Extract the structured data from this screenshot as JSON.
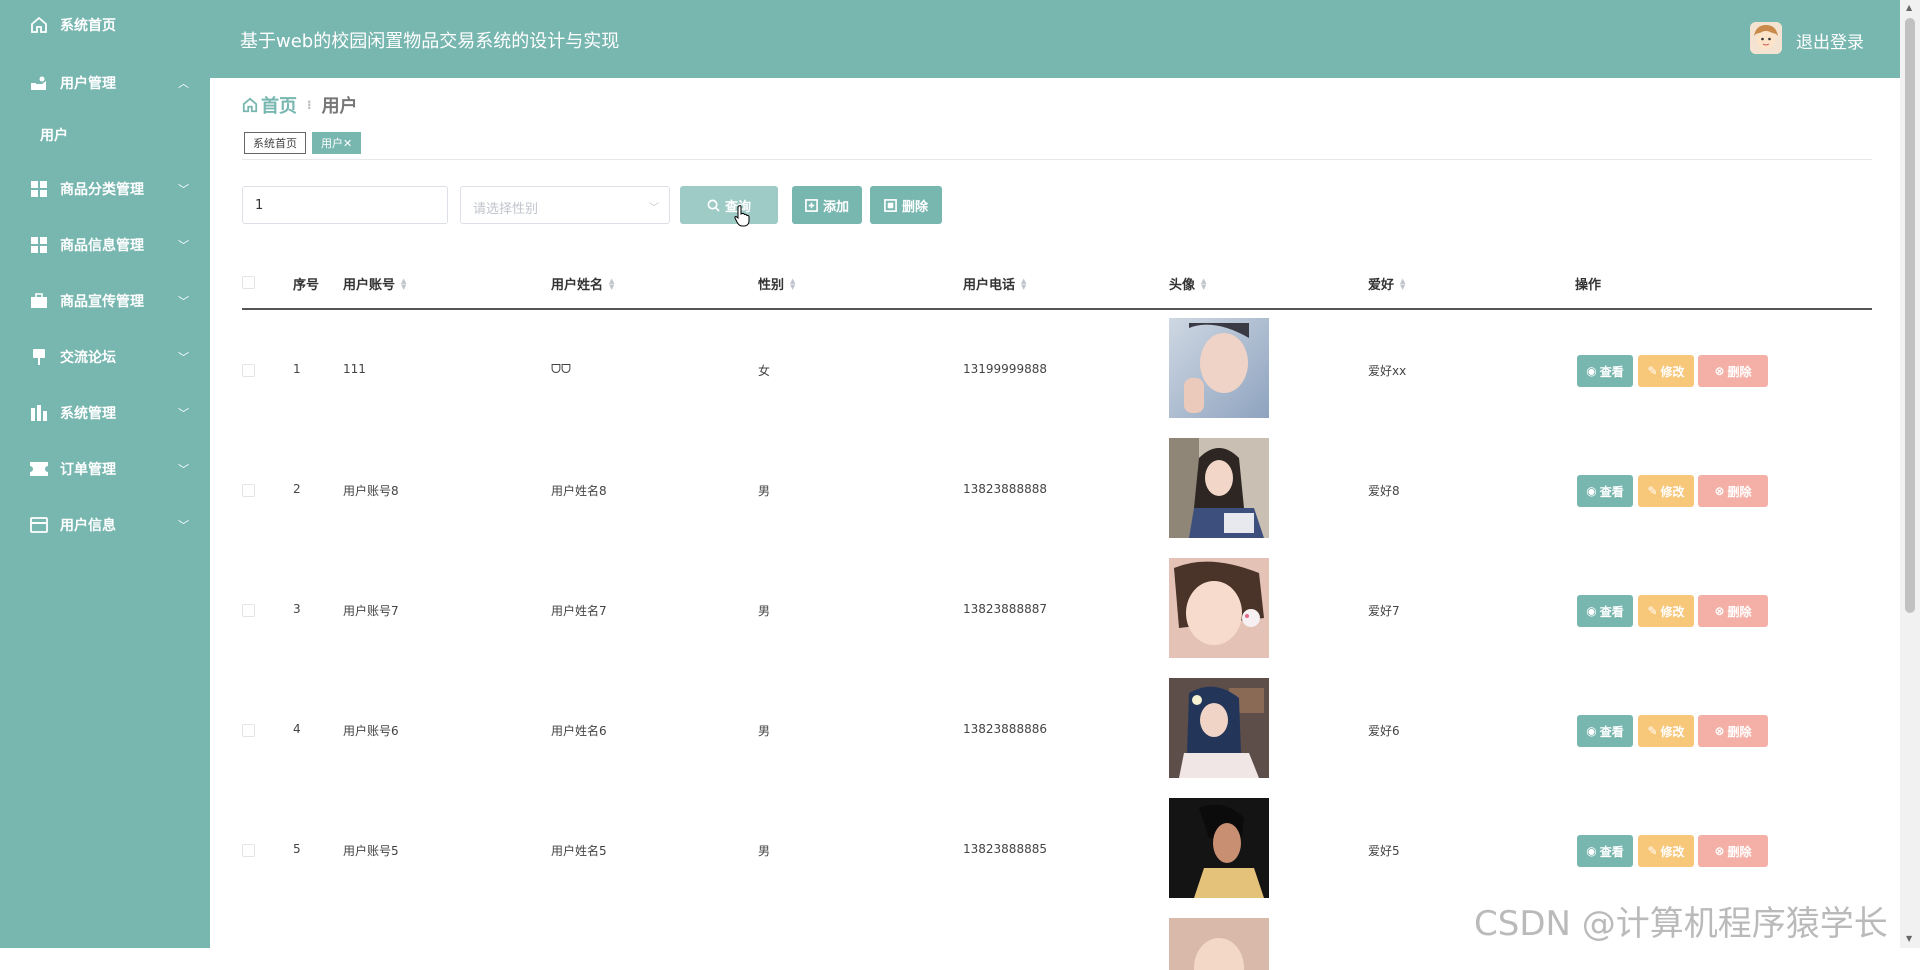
{
  "app": {
    "title": "基于web的校园闲置物品交易系统的设计与实现",
    "logout": "退出登录",
    "accent": "#78b6b0"
  },
  "sidebar": {
    "items": [
      {
        "label": "系统首页",
        "icon": "home-icon"
      },
      {
        "label": "用户管理",
        "icon": "user-manage-icon",
        "expanded": true
      },
      {
        "label": "用户",
        "sub": true
      },
      {
        "label": "商品分类管理",
        "icon": "grid-icon"
      },
      {
        "label": "商品信息管理",
        "icon": "grid-icon"
      },
      {
        "label": "商品宣传管理",
        "icon": "briefcase-icon"
      },
      {
        "label": "交流论坛",
        "icon": "pin-icon"
      },
      {
        "label": "系统管理",
        "icon": "chart-icon"
      },
      {
        "label": "订单管理",
        "icon": "ticket-icon"
      },
      {
        "label": "用户信息",
        "icon": "card-icon"
      }
    ]
  },
  "breadcrumb": {
    "home": "首页",
    "current": "用户"
  },
  "tabs": [
    {
      "label": "系统首页"
    },
    {
      "label": "用户✕",
      "active": true
    }
  ],
  "filters": {
    "search_value": "1",
    "gender_placeholder": "请选择性别"
  },
  "buttons": {
    "query": "查询",
    "add": "添加",
    "delete": "删除"
  },
  "table": {
    "columns": [
      "序号",
      "用户账号",
      "用户姓名",
      "性别",
      "用户电话",
      "头像",
      "爱好",
      "操作"
    ],
    "actions": {
      "view": "查看",
      "edit": "修改",
      "delete": "删除"
    },
    "rows": [
      {
        "index": "1",
        "account": "111",
        "name": "ᗜᗜ",
        "gender": "女",
        "phone": "13199999888",
        "hobby": "爱好xx"
      },
      {
        "index": "2",
        "account": "用户账号8",
        "name": "用户姓名8",
        "gender": "男",
        "phone": "13823888888",
        "hobby": "爱好8"
      },
      {
        "index": "3",
        "account": "用户账号7",
        "name": "用户姓名7",
        "gender": "男",
        "phone": "13823888887",
        "hobby": "爱好7"
      },
      {
        "index": "4",
        "account": "用户账号6",
        "name": "用户姓名6",
        "gender": "男",
        "phone": "13823888886",
        "hobby": "爱好6"
      },
      {
        "index": "5",
        "account": "用户账号5",
        "name": "用户姓名5",
        "gender": "男",
        "phone": "13823888885",
        "hobby": "爱好5"
      }
    ]
  },
  "watermark": "CSDN @计算机程序猿学长"
}
